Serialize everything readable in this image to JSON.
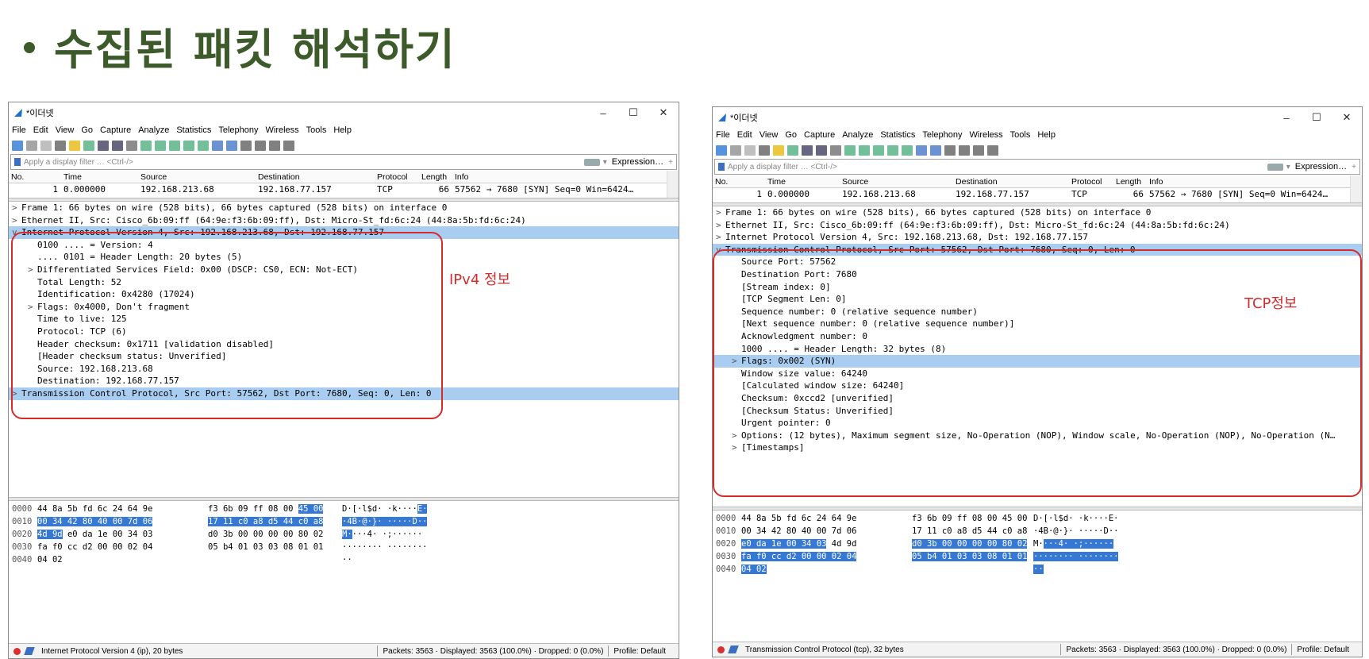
{
  "slide_title": "수집된 패킷 해석하기",
  "menu": [
    "File",
    "Edit",
    "View",
    "Go",
    "Capture",
    "Analyze",
    "Statistics",
    "Telephony",
    "Wireless",
    "Tools",
    "Help"
  ],
  "window_controls": {
    "minimize": "–",
    "maximize": "☐",
    "close": "✕"
  },
  "window_title": "*이더넷",
  "filter_placeholder": "Apply a display filter … <Ctrl-/>",
  "expression_label": "Expression…",
  "plus_label": "+",
  "columns": [
    "No.",
    "Time",
    "Source",
    "Destination",
    "Protocol",
    "Length",
    "Info"
  ],
  "packet_row": [
    "1",
    "0.000000",
    "192.168.213.68",
    "192.168.77.157",
    "TCP",
    "66",
    "57562 → 7680 [SYN] Seq=0 Win=6424…"
  ],
  "left": {
    "tree": [
      {
        "exp": ">",
        "text": "Frame 1: 66 bytes on wire (528 bits), 66 bytes captured (528 bits) on interface 0",
        "indent": 0
      },
      {
        "exp": ">",
        "text": "Ethernet II, Src: Cisco_6b:09:ff (64:9e:f3:6b:09:ff), Dst: Micro-St_fd:6c:24 (44:8a:5b:fd:6c:24)",
        "indent": 0
      },
      {
        "exp": "v",
        "text": "Internet Protocol Version 4, Src: 192.168.213.68, Dst: 192.168.77.157",
        "indent": 0,
        "sel": true
      },
      {
        "exp": "",
        "text": "0100 .... = Version: 4",
        "indent": 1
      },
      {
        "exp": "",
        "text": ".... 0101 = Header Length: 20 bytes (5)",
        "indent": 1
      },
      {
        "exp": ">",
        "text": "Differentiated Services Field: 0x00 (DSCP: CS0, ECN: Not-ECT)",
        "indent": 1
      },
      {
        "exp": "",
        "text": "Total Length: 52",
        "indent": 1
      },
      {
        "exp": "",
        "text": "Identification: 0x4280 (17024)",
        "indent": 1
      },
      {
        "exp": ">",
        "text": "Flags: 0x4000, Don't fragment",
        "indent": 1
      },
      {
        "exp": "",
        "text": "Time to live: 125",
        "indent": 1
      },
      {
        "exp": "",
        "text": "Protocol: TCP (6)",
        "indent": 1
      },
      {
        "exp": "",
        "text": "Header checksum: 0x1711 [validation disabled]",
        "indent": 1
      },
      {
        "exp": "",
        "text": "[Header checksum status: Unverified]",
        "indent": 1
      },
      {
        "exp": "",
        "text": "Source: 192.168.213.68",
        "indent": 1
      },
      {
        "exp": "",
        "text": "Destination: 192.168.77.157",
        "indent": 1
      },
      {
        "exp": ">",
        "text": "Transmission Control Protocol, Src Port: 57562, Dst Port: 7680, Seq: 0, Len: 0",
        "indent": 0,
        "sel": true
      }
    ],
    "hex": [
      {
        "off": "0000",
        "b1": "44 8a 5b fd 6c 24 64 9e",
        "b2": "f3 6b 09 ff 08 00",
        "b2h": "45 00",
        "a1": "D·[·l$d· ·k····",
        "a1h": "E·"
      },
      {
        "off": "0010",
        "b1h": "00 34 42 80 40 00 7d 06",
        "b2h": "17 11 c0 a8 d5 44 c0 a8",
        "a1h": "·4B·@·}· ·····D··"
      },
      {
        "off": "0020",
        "b1h": "4d 9d",
        "b1": "e0 da 1e 00 34 03",
        "b2": "d0 3b 00 00 00 00 80 02",
        "a1h": "M·",
        "a1": "···4· ·;······"
      },
      {
        "off": "0030",
        "b1": "fa f0 cc d2 00 00 02 04",
        "b2": "05 b4 01 03 03 08 01 01",
        "a1": "········ ········"
      },
      {
        "off": "0040",
        "b1": "04 02",
        "b2": "",
        "a1": "··"
      }
    ],
    "status_text": "Internet Protocol Version 4 (ip), 20 bytes",
    "status_packets": "Packets: 3563 · Displayed: 3563 (100.0%) · Dropped: 0 (0.0%)",
    "status_profile": "Profile: Default",
    "annotation": "IPv4 정보"
  },
  "right": {
    "tree": [
      {
        "exp": ">",
        "text": "Frame 1: 66 bytes on wire (528 bits), 66 bytes captured (528 bits) on interface 0",
        "indent": 0
      },
      {
        "exp": ">",
        "text": "Ethernet II, Src: Cisco_6b:09:ff (64:9e:f3:6b:09:ff), Dst: Micro-St_fd:6c:24 (44:8a:5b:fd:6c:24)",
        "indent": 0
      },
      {
        "exp": ">",
        "text": "Internet Protocol Version 4, Src: 192.168.213.68, Dst: 192.168.77.157",
        "indent": 0
      },
      {
        "exp": "v",
        "text": "Transmission Control Protocol, Src Port: 57562, Dst Port: 7680, Seq: 0, Len: 0",
        "indent": 0,
        "sel": true
      },
      {
        "exp": "",
        "text": "Source Port: 57562",
        "indent": 1
      },
      {
        "exp": "",
        "text": "Destination Port: 7680",
        "indent": 1
      },
      {
        "exp": "",
        "text": "[Stream index: 0]",
        "indent": 1
      },
      {
        "exp": "",
        "text": "[TCP Segment Len: 0]",
        "indent": 1
      },
      {
        "exp": "",
        "text": "Sequence number: 0    (relative sequence number)",
        "indent": 1
      },
      {
        "exp": "",
        "text": "[Next sequence number: 0    (relative sequence number)]",
        "indent": 1
      },
      {
        "exp": "",
        "text": "Acknowledgment number: 0",
        "indent": 1
      },
      {
        "exp": "",
        "text": "1000 .... = Header Length: 32 bytes (8)",
        "indent": 1
      },
      {
        "exp": ">",
        "text": "Flags: 0x002 (SYN)",
        "indent": 1,
        "sel": true
      },
      {
        "exp": "",
        "text": "Window size value: 64240",
        "indent": 1
      },
      {
        "exp": "",
        "text": "[Calculated window size: 64240]",
        "indent": 1
      },
      {
        "exp": "",
        "text": "Checksum: 0xccd2 [unverified]",
        "indent": 1
      },
      {
        "exp": "",
        "text": "[Checksum Status: Unverified]",
        "indent": 1
      },
      {
        "exp": "",
        "text": "Urgent pointer: 0",
        "indent": 1
      },
      {
        "exp": ">",
        "text": "Options: (12 bytes), Maximum segment size, No-Operation (NOP), Window scale, No-Operation (NOP), No-Operation (N…",
        "indent": 1
      },
      {
        "exp": ">",
        "text": "[Timestamps]",
        "indent": 1
      }
    ],
    "hex": [
      {
        "off": "0000",
        "b1": "44 8a 5b fd 6c 24 64 9e",
        "b2": "f3 6b 09 ff 08 00 45 00",
        "a1": "D·[·l$d· ·k····E·"
      },
      {
        "off": "0010",
        "b1": "00 34 42 80 40 00 7d 06",
        "b2": "17 11 c0 a8 d5 44 c0 a8",
        "a1": "·4B·@·}· ·····D··"
      },
      {
        "off": "0020",
        "b1": "4d 9d",
        "b1h": "e0 da 1e 00 34 03",
        "b2h": "d0 3b 00 00 00 00 80 02",
        "a1": "M·",
        "a1h": "···4· ·;······"
      },
      {
        "off": "0030",
        "b1h": "fa f0 cc d2 00 00 02 04",
        "b2h": "05 b4 01 03 03 08 01 01",
        "a1h": "········ ········"
      },
      {
        "off": "0040",
        "b1h": "04 02",
        "b2": "",
        "a1h": "··"
      }
    ],
    "status_text": "Transmission Control Protocol (tcp), 32 bytes",
    "status_packets": "Packets: 3563 · Displayed: 3563 (100.0%) · Dropped: 0 (0.0%)",
    "status_profile": "Profile: Default",
    "annotation": "TCP정보"
  },
  "colors": {
    "title": "#3d5a2a",
    "selection": "#a8cdf0",
    "hex_highlight": "#3578d6",
    "annotation": "#d62b2b"
  }
}
